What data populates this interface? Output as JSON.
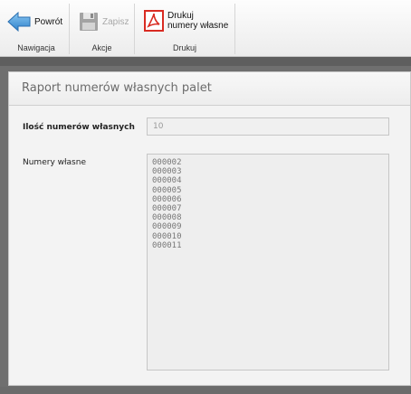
{
  "toolbar": {
    "back_label": "Powrót",
    "save_label": "Zapisz",
    "print_label_line1": "Drukuj",
    "print_label_line2": "numery własne",
    "groups": {
      "navigation": "Nawigacja",
      "actions": "Akcje",
      "print": "Drukuj"
    }
  },
  "panel": {
    "title": "Raport numerów własnych palet",
    "count_label": "Ilość numerów własnych",
    "count_value": "10",
    "numbers_label": "Numery własne",
    "numbers_text": "000002\n000003\n000004\n000005\n000006\n000007\n000008\n000009\n000010\n000011"
  },
  "colors": {
    "back_arrow": "#3a8fd6",
    "pdf_icon": "#d92b22",
    "save_disabled": "#9a9a9a"
  }
}
